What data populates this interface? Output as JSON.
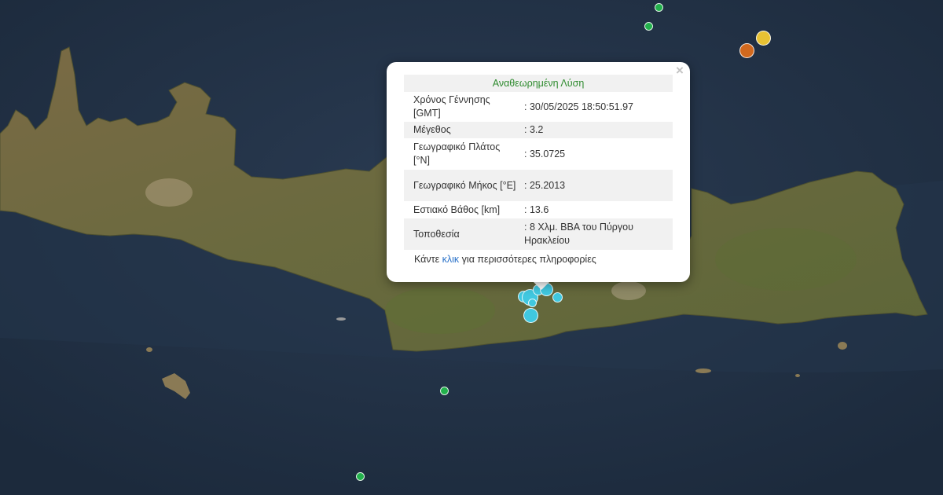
{
  "popup": {
    "header": "Αναθεωρημένη Λύση",
    "rows": [
      {
        "label": "Χρόνος Γέννησης [GMT]",
        "value": ": 30/05/2025 18:50:51.97"
      },
      {
        "label": "Μέγεθος",
        "value": ": 3.2"
      },
      {
        "label": "Γεωγραφικό Πλάτος [°N]",
        "value": ": 35.0725"
      },
      {
        "label": "Γεωγραφικό Μήκος [°E]",
        "value": ": 25.2013"
      },
      {
        "label": "Εστιακό Βάθος [km]",
        "value": ": 13.6"
      },
      {
        "label": "Τοποθεσία",
        "value": ": 8 Χλμ. ΒΒΑ του Πύργου Ηρακλείου"
      }
    ],
    "more_prefix": "Κάντε ",
    "more_link": "κλικ",
    "more_suffix": " για περισσότερες πληροφορίες",
    "close_glyph": "×"
  },
  "colors": {
    "sea": "#223246",
    "land": "#6e6e44",
    "marker_cyan": "#40c8e0",
    "marker_green": "#22b14c",
    "marker_orange": "#d2691e",
    "marker_yellow": "#e8c233",
    "header_green": "#2e8b2e",
    "link_blue": "#2a72c9"
  }
}
